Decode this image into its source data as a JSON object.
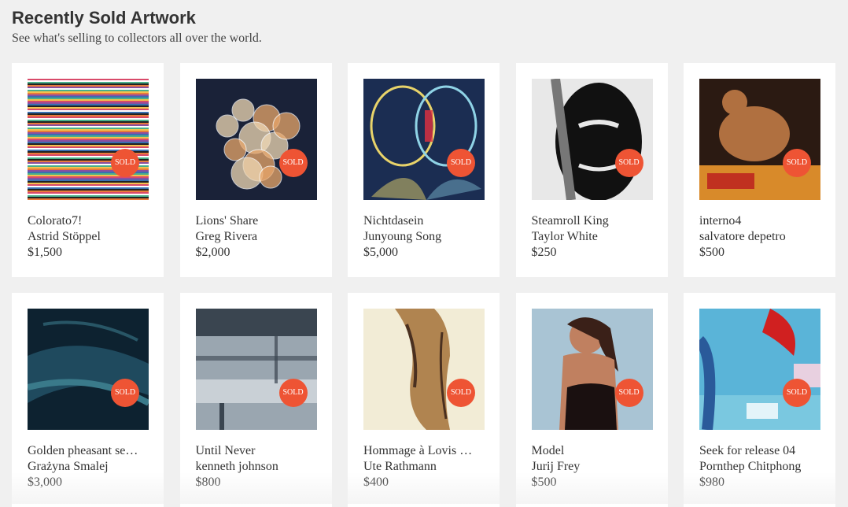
{
  "header": {
    "title": "Recently Sold Artwork",
    "subtitle": "See what's selling to collectors all over the world."
  },
  "sold_badge": "SOLD",
  "artworks": [
    {
      "title": "Colorato7!",
      "artist": "Astrid Stöppel",
      "price": "$1,500",
      "palette": [
        "#d94a6a",
        "#3a6fb0",
        "#f2c14e",
        "#8a4fa0"
      ]
    },
    {
      "title": "Lions' Share",
      "artist": "Greg Rivera",
      "price": "$2,000",
      "palette": [
        "#1a2238",
        "#e8a66a",
        "#f0d9b5"
      ]
    },
    {
      "title": "Nichtdasein",
      "artist": "Junyoung Song",
      "price": "$5,000",
      "palette": [
        "#1b2d52",
        "#e8d36a",
        "#8fd3e6"
      ]
    },
    {
      "title": "Steamroll King",
      "artist": "Taylor White",
      "price": "$250",
      "palette": [
        "#111111",
        "#e8e8e8",
        "#777777"
      ]
    },
    {
      "title": "interno4",
      "artist": "salvatore depetro",
      "price": "$500",
      "palette": [
        "#2b1a12",
        "#b07040",
        "#d88a2a"
      ]
    },
    {
      "title": "Golden pheasant se…",
      "artist": "Grażyna Smalej",
      "price": "$3,000",
      "palette": [
        "#0d2230",
        "#1f4a5e",
        "#3a7a8a"
      ]
    },
    {
      "title": "Until Never",
      "artist": "kenneth johnson",
      "price": "$800",
      "palette": [
        "#3a4550",
        "#9aa6b0",
        "#c9d0d6"
      ]
    },
    {
      "title": "Hommage à Lovis …",
      "artist": "Ute Rathmann",
      "price": "$400",
      "palette": [
        "#f2ecd6",
        "#b08450",
        "#4a3020"
      ]
    },
    {
      "title": "Model",
      "artist": "Jurij Frey",
      "price": "$500",
      "palette": [
        "#a9c4d4",
        "#1a1010",
        "#c08060"
      ]
    },
    {
      "title": "Seek for release 04",
      "artist": "Pornthep Chitphong",
      "price": "$980",
      "palette": [
        "#5ab4d8",
        "#d02020",
        "#e8d0e0"
      ]
    }
  ]
}
